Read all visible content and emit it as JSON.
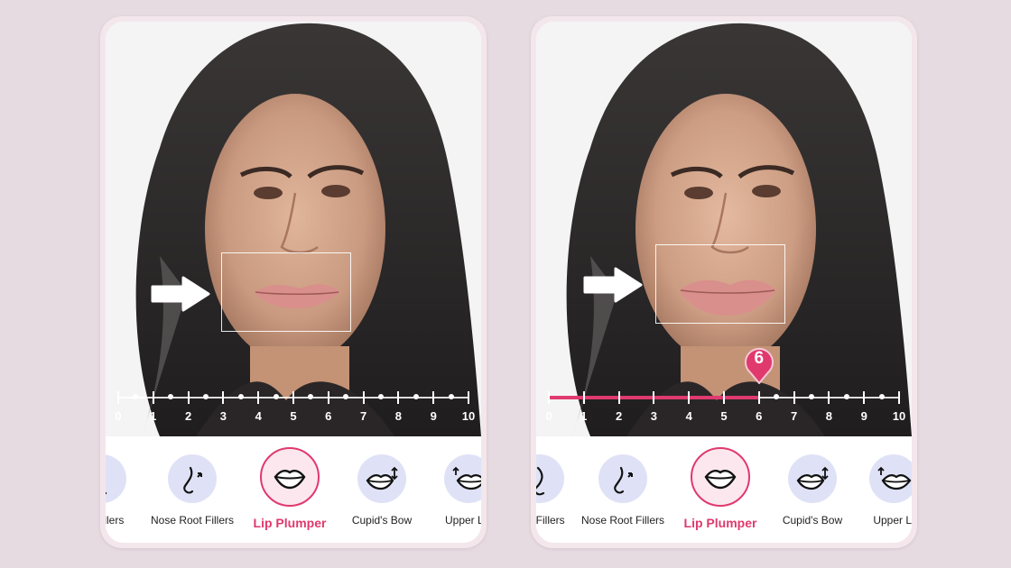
{
  "panels": [
    {
      "id": "before",
      "slider": {
        "min": 0,
        "max": 10,
        "value": null,
        "labels": [
          "0",
          "1",
          "2",
          "3",
          "4",
          "5",
          "6",
          "7",
          "8",
          "9",
          "10"
        ]
      },
      "tools": [
        {
          "label": "Nose Bridge Fillers",
          "visible_label": "ge Fillers",
          "icon": "nose-bridge-icon",
          "active": false
        },
        {
          "label": "Nose Root Fillers",
          "icon": "nose-root-icon",
          "active": false
        },
        {
          "label": "Lip Plumper",
          "icon": "lips-icon",
          "active": true
        },
        {
          "label": "Cupid's Bow",
          "icon": "cupids-bow-icon",
          "active": false
        },
        {
          "label": "Upper Lip",
          "icon": "upper-lip-icon",
          "active": false
        }
      ]
    },
    {
      "id": "after",
      "slider": {
        "min": 0,
        "max": 10,
        "value": 6,
        "value_label": "6",
        "labels": [
          "0",
          "1",
          "2",
          "3",
          "4",
          "5",
          "6",
          "7",
          "8",
          "9",
          "10"
        ]
      },
      "tools": [
        {
          "label": "Nose Bridge Fillers",
          "visible_label": "dge Fillers",
          "icon": "nose-bridge-icon",
          "active": false
        },
        {
          "label": "Nose Root Fillers",
          "icon": "nose-root-icon",
          "active": false
        },
        {
          "label": "Lip Plumper",
          "icon": "lips-icon",
          "active": true
        },
        {
          "label": "Cupid's Bow",
          "icon": "cupids-bow-icon",
          "active": false
        },
        {
          "label": "Upper Lip",
          "visible_label": "Upper Li",
          "icon": "upper-lip-icon",
          "active": false
        }
      ]
    }
  ],
  "colors": {
    "accent": "#e0396d",
    "tool_bg": "#dfe2f6",
    "active_bg": "#fce7ef",
    "page_bg": "#e6dbe0"
  }
}
